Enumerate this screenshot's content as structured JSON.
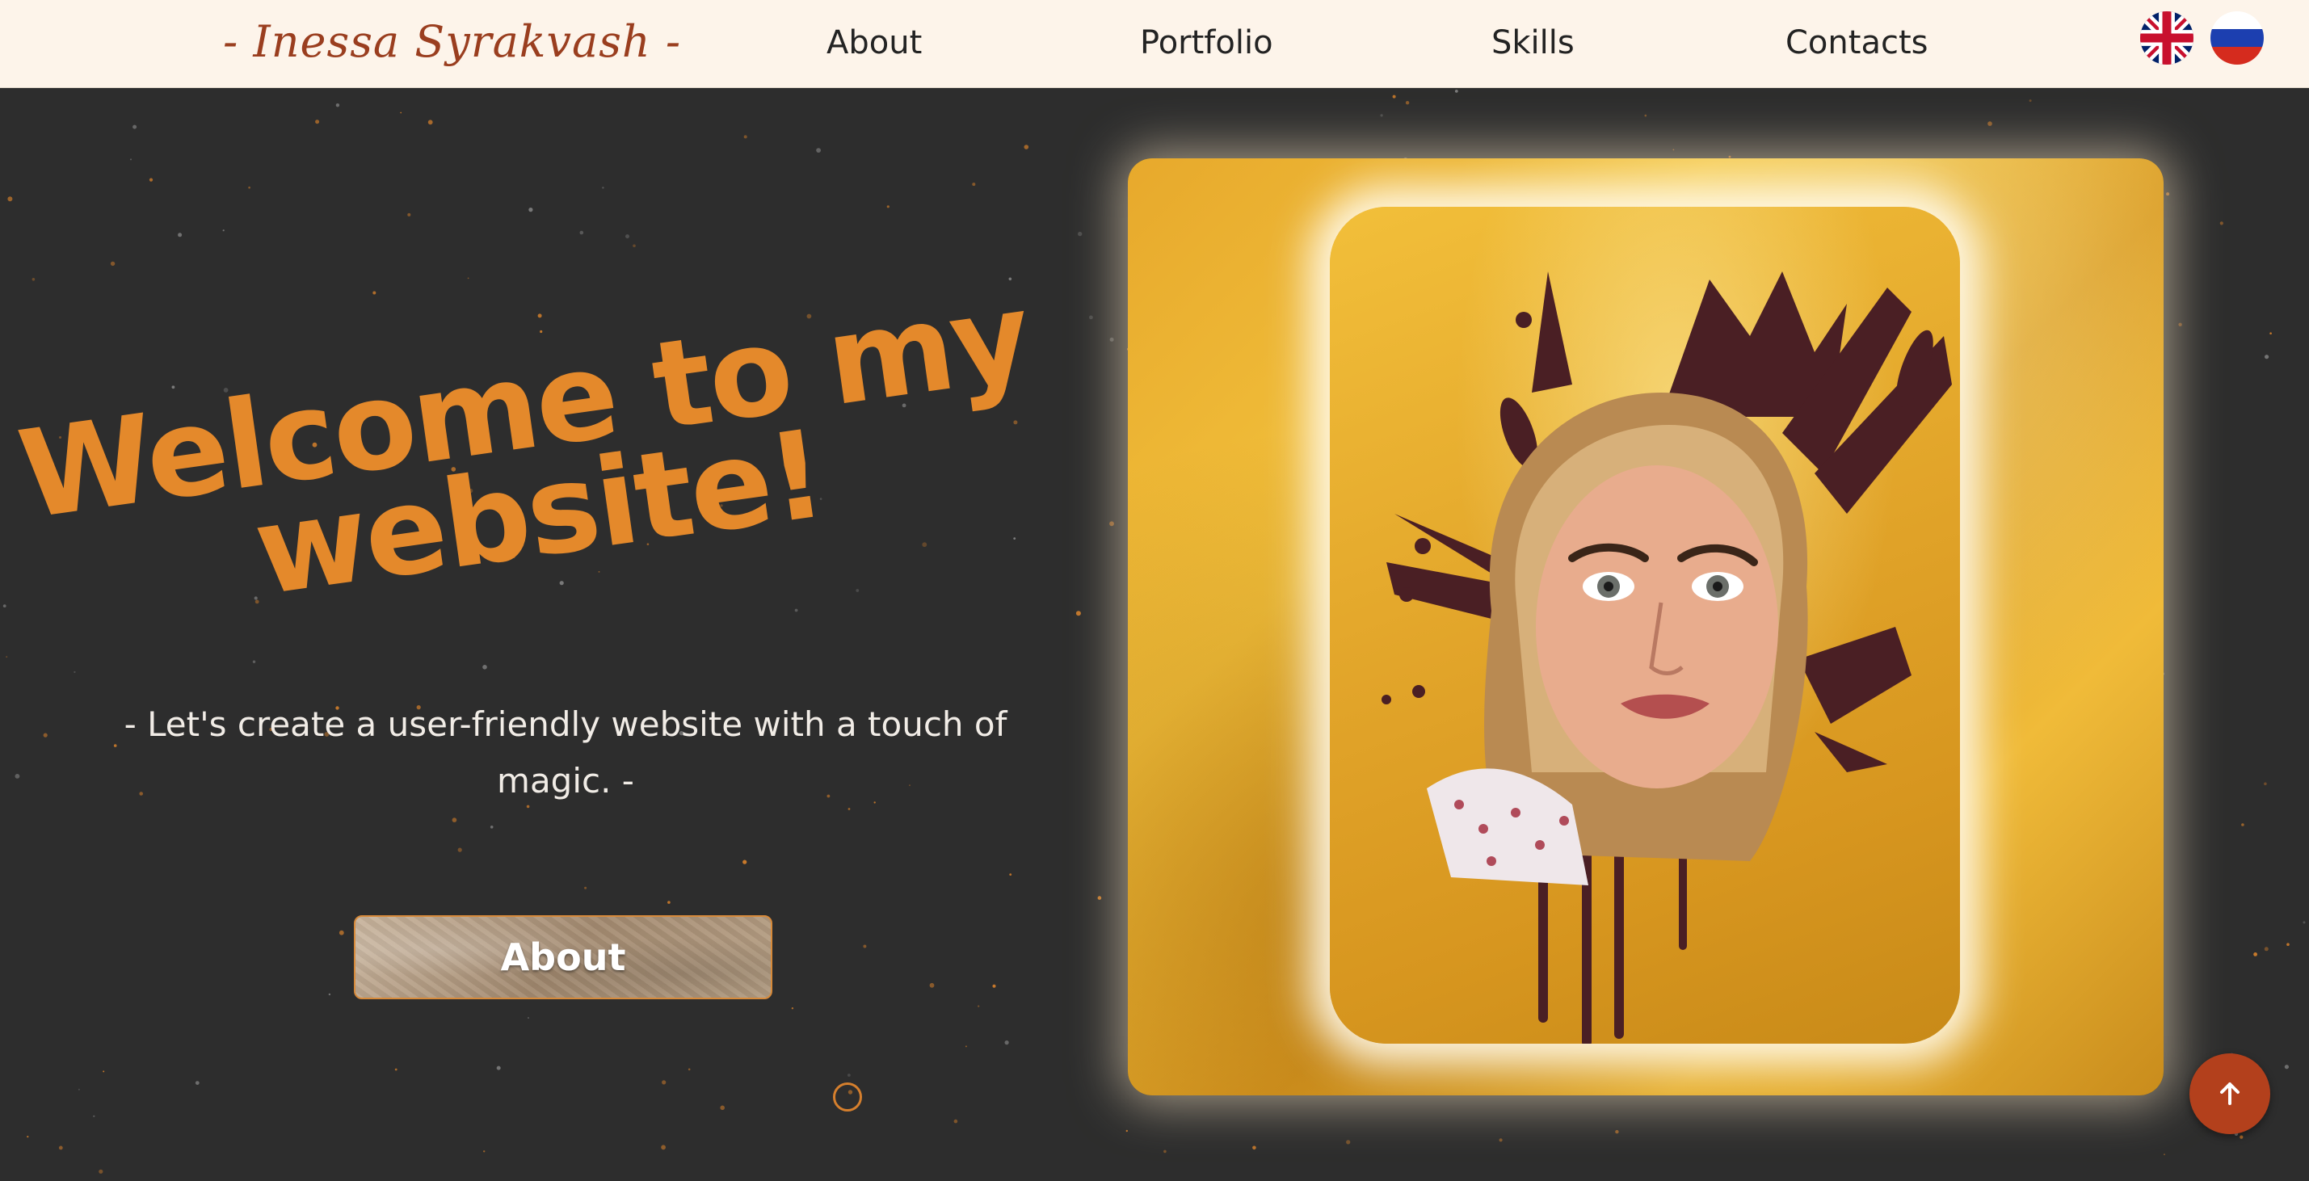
{
  "header": {
    "logo": "- Inessa Syrakvash -",
    "nav": [
      {
        "label": "About"
      },
      {
        "label": "Portfolio"
      },
      {
        "label": "Skills"
      },
      {
        "label": "Contacts"
      }
    ],
    "languages": [
      {
        "flag": "uk-flag-icon"
      },
      {
        "flag": "russia-flag-icon"
      }
    ]
  },
  "hero": {
    "title_line1": "Welcome to my",
    "title_line2": "website!",
    "subtitle_line1": "- Let's create a user-friendly website with a touch of",
    "subtitle_line2": "magic. -",
    "button_label": "About"
  },
  "portrait": {
    "description_icon": "portrait-illustration"
  },
  "scroll_top": {
    "icon": "arrow-up-icon"
  },
  "colors": {
    "accent": "#e4892b",
    "logo": "#9a3e1f",
    "background": "#2d2d2d",
    "header_bg": "#fdf4ea",
    "scroll_top_bg": "#b3401c"
  }
}
